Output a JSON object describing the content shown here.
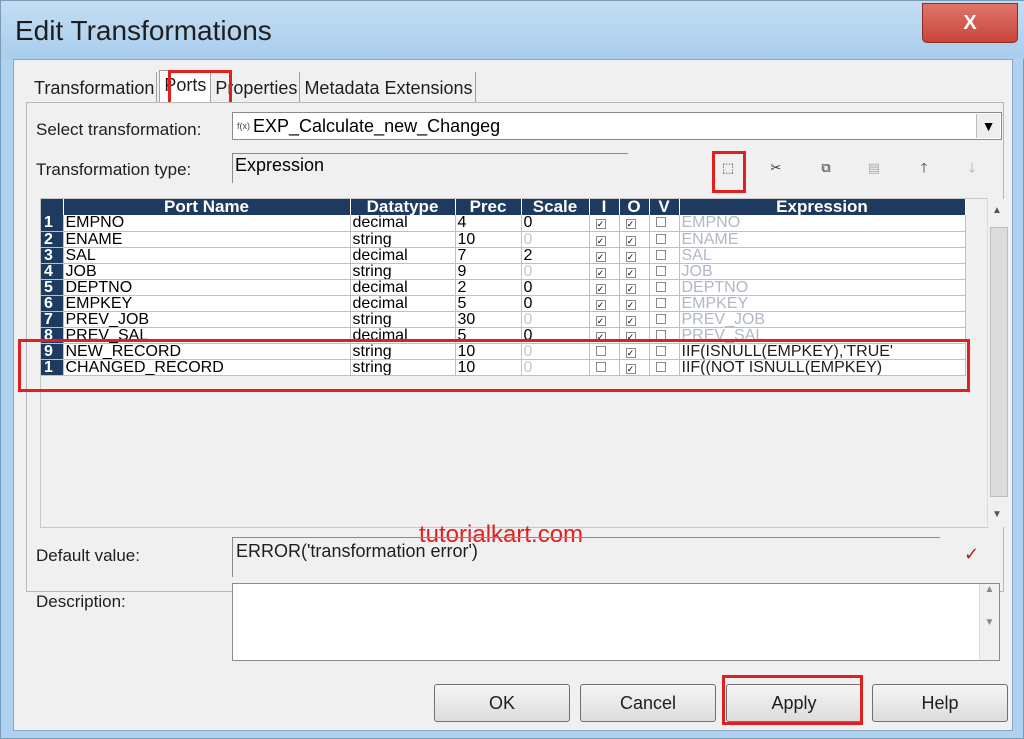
{
  "window": {
    "title": "Edit Transformations",
    "close": "X"
  },
  "tabs": [
    {
      "label": "Transformation"
    },
    {
      "label": "Ports"
    },
    {
      "label": "Properties"
    },
    {
      "label": "Metadata Extensions"
    }
  ],
  "select_transformation": {
    "label": "Select transformation:",
    "icon": "f(x)",
    "value": "EXP_Calculate_new_Changeg"
  },
  "transformation_type": {
    "label": "Transformation type:",
    "value": "Expression"
  },
  "toolbar": {
    "new_port": "new-port-icon",
    "cut": "scissors-icon",
    "copy": "copy-icon",
    "paste": "paste-icon",
    "move_up": "arrow-up-icon",
    "move_down": "arrow-down-icon"
  },
  "grid": {
    "columns": [
      "Port Name",
      "Datatype",
      "Prec",
      "Scale",
      "I",
      "O",
      "V",
      "Expression"
    ],
    "rows": [
      {
        "num": "1",
        "name": "EMPNO",
        "type": "decimal",
        "prec": "4",
        "scale": "0",
        "scale_grey": false,
        "i": true,
        "o": true,
        "v": false,
        "expr": "EMPNO",
        "expr_dark": false
      },
      {
        "num": "2",
        "name": "ENAME",
        "type": "string",
        "prec": "10",
        "scale": "0",
        "scale_grey": true,
        "i": true,
        "o": true,
        "v": false,
        "expr": "ENAME",
        "expr_dark": false
      },
      {
        "num": "3",
        "name": "SAL",
        "type": "decimal",
        "prec": "7",
        "scale": "2",
        "scale_grey": false,
        "i": true,
        "o": true,
        "v": false,
        "expr": "SAL",
        "expr_dark": false
      },
      {
        "num": "4",
        "name": "JOB",
        "type": "string",
        "prec": "9",
        "scale": "0",
        "scale_grey": true,
        "i": true,
        "o": true,
        "v": false,
        "expr": "JOB",
        "expr_dark": false
      },
      {
        "num": "5",
        "name": "DEPTNO",
        "type": "decimal",
        "prec": "2",
        "scale": "0",
        "scale_grey": false,
        "i": true,
        "o": true,
        "v": false,
        "expr": "DEPTNO",
        "expr_dark": false
      },
      {
        "num": "6",
        "name": "EMPKEY",
        "type": "decimal",
        "prec": "5",
        "scale": "0",
        "scale_grey": false,
        "i": true,
        "o": true,
        "v": false,
        "expr": "EMPKEY",
        "expr_dark": false
      },
      {
        "num": "7",
        "name": "PREV_JOB",
        "type": "string",
        "prec": "30",
        "scale": "0",
        "scale_grey": true,
        "i": true,
        "o": true,
        "v": false,
        "expr": "PREV_JOB",
        "expr_dark": false
      },
      {
        "num": "8",
        "name": "PREV_SAL",
        "type": "decimal",
        "prec": "5",
        "scale": "0",
        "scale_grey": false,
        "i": true,
        "o": true,
        "v": false,
        "expr": "PREV_SAL",
        "expr_dark": false
      },
      {
        "num": "9",
        "name": "NEW_RECORD",
        "type": "string",
        "prec": "10",
        "scale": "0",
        "scale_grey": true,
        "i": false,
        "o": true,
        "v": false,
        "expr": "IIF(ISNULL(EMPKEY),'TRUE'",
        "expr_dark": true
      },
      {
        "num": "1",
        "name": "CHANGED_RECORD",
        "type": "string",
        "prec": "10",
        "scale": "0",
        "scale_grey": true,
        "i": false,
        "o": true,
        "v": false,
        "expr": "IIF((NOT ISNULL(EMPKEY)",
        "expr_dark": true
      }
    ]
  },
  "watermark": "tutorialkart.com",
  "default_value": {
    "label": "Default value:",
    "value": "ERROR('transformation error')"
  },
  "description": {
    "label": "Description:",
    "value": ""
  },
  "buttons": {
    "ok": "OK",
    "cancel": "Cancel",
    "apply": "Apply",
    "help": "Help"
  },
  "colors": {
    "header_bg": "#1f3a5f",
    "highlight": "#e02020",
    "titlebar": "#aed2ef"
  }
}
